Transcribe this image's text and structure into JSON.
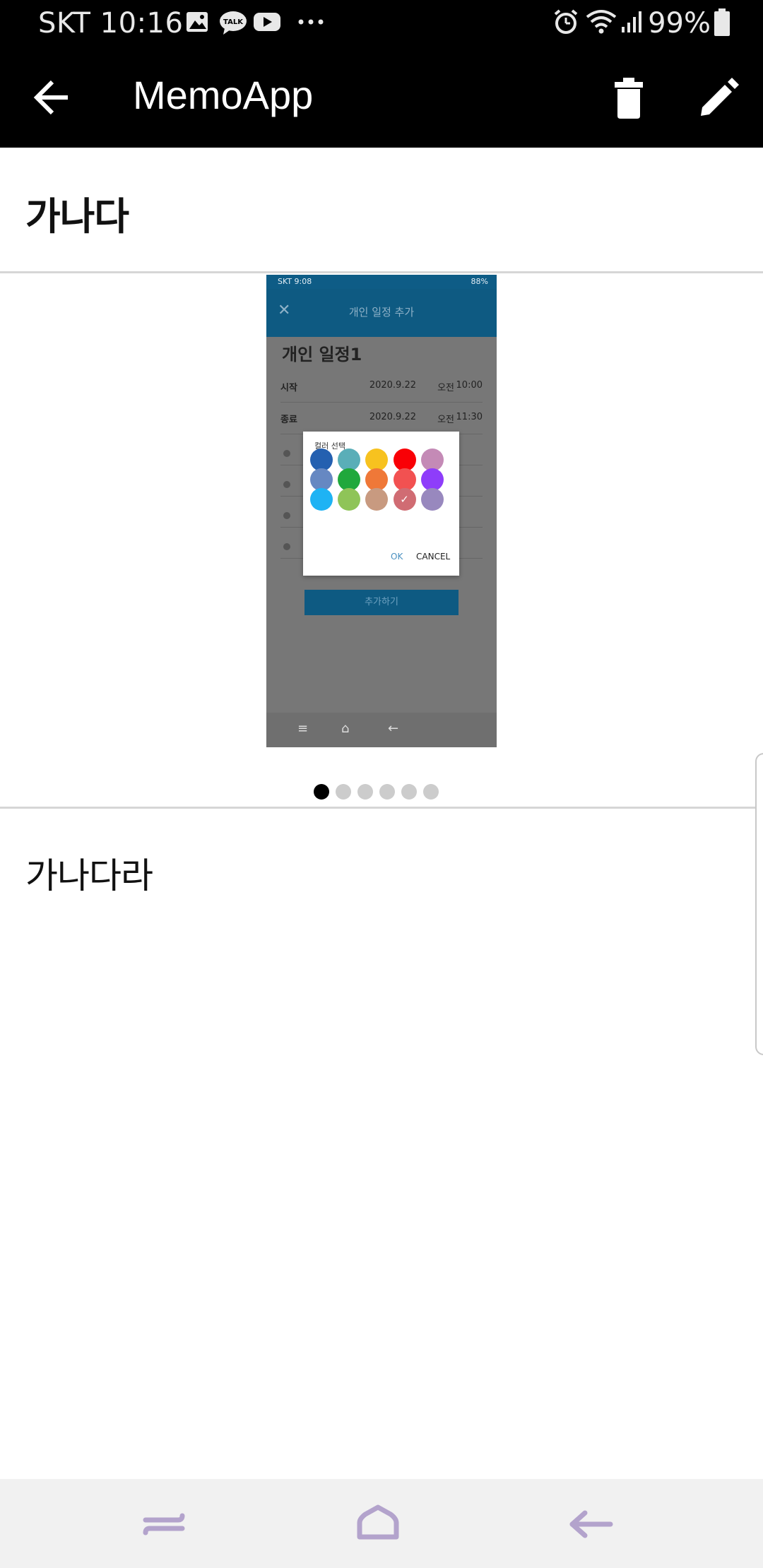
{
  "status_bar": {
    "carrier_time": "SKT 10:16",
    "battery": "99%",
    "notification_icons": [
      "gallery-icon",
      "kakaotalk-icon",
      "youtube-icon",
      "more-dots-icon"
    ],
    "system_icons": [
      "alarm-icon",
      "wifi-icon",
      "signal-icon",
      "battery-icon"
    ],
    "talk_label": "TALK"
  },
  "app_bar": {
    "title": "MemoApp",
    "actions": [
      "back-arrow-icon",
      "trash-icon",
      "pencil-icon"
    ]
  },
  "memo": {
    "title": "가나다",
    "body": "가나다라"
  },
  "attachment": {
    "status": {
      "left": "SKT 9:08",
      "right": "88%"
    },
    "toolbar_title": "개인 일정 추가",
    "close_glyph": "✕",
    "event_title": "개인 일정1",
    "rows": [
      {
        "label": "시작",
        "date": "2020.9.22",
        "ampm": "오전",
        "time": "10:00"
      },
      {
        "label": "종료",
        "date": "2020.9.22",
        "ampm": "오전",
        "time": "11:30"
      }
    ],
    "add_button": "추가하기",
    "dialog": {
      "title": "컬러 선택",
      "ok": "OK",
      "cancel": "CANCEL",
      "check": "✓",
      "selected_index": 13,
      "colors": [
        "#2460b0",
        "#5aaeb8",
        "#f7c21f",
        "#f90006",
        "#c48ab6",
        "#6688c2",
        "#20a83c",
        "#ef7838",
        "#f25151",
        "#8e3dfa",
        "#1eb3f4",
        "#8fc458",
        "#c89a80",
        "#d06c73",
        "#9888be"
      ]
    },
    "nav_glyphs": [
      "≡",
      "⌂",
      "←"
    ]
  },
  "pager": {
    "count": 6,
    "active": 0
  },
  "colors": {
    "app_bar": "#000000",
    "dot_active": "#000000",
    "dot_inactive": "#cccccc",
    "nav_icons": "#b3a3cc"
  }
}
